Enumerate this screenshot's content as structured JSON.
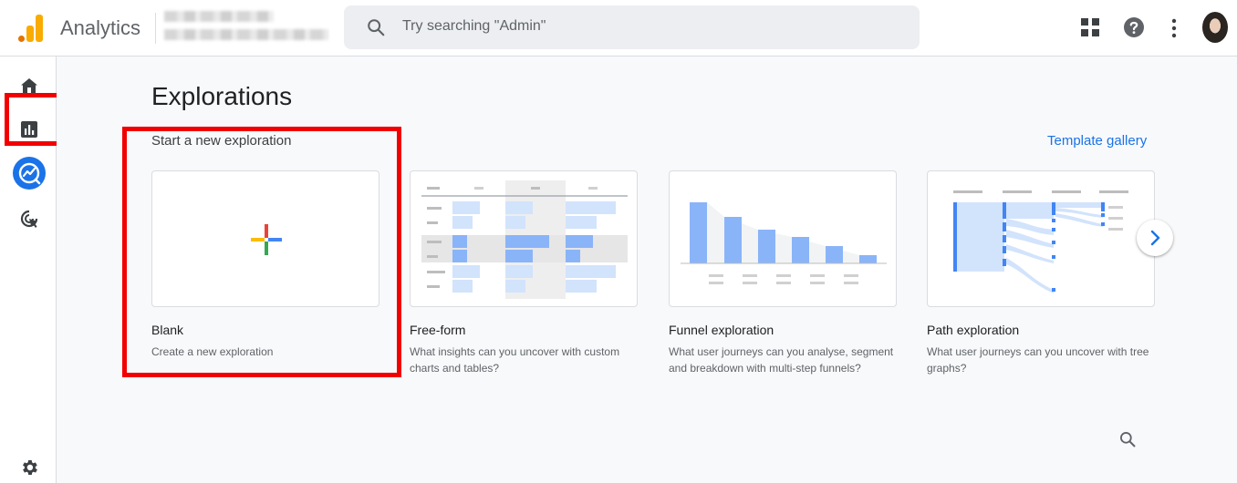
{
  "header": {
    "app_title": "Analytics",
    "search_placeholder": "Try searching \"Admin\""
  },
  "sidebar": {
    "items": [
      {
        "name": "home",
        "icon": "home-icon"
      },
      {
        "name": "reports",
        "icon": "bar-chart-icon"
      },
      {
        "name": "explore",
        "icon": "explore-icon",
        "active": true
      },
      {
        "name": "advertising",
        "icon": "target-cursor-icon"
      },
      {
        "name": "admin",
        "icon": "gear-icon"
      }
    ]
  },
  "main": {
    "title": "Explorations",
    "subheading": "Start a new exploration",
    "template_link": "Template gallery",
    "cards": [
      {
        "title": "Blank",
        "description": "Create a new exploration"
      },
      {
        "title": "Free-form",
        "description": "What insights can you uncover with custom charts and tables?"
      },
      {
        "title": "Funnel exploration",
        "description": "What user journeys can you analyse, segment and breakdown with multi-step funnels?"
      },
      {
        "title": "Path exploration",
        "description": "What user journeys can you uncover with tree graphs?"
      }
    ]
  },
  "colors": {
    "accent": "#1a73e8",
    "highlight": "#f20000",
    "logo_orange": "#f9ab00"
  }
}
